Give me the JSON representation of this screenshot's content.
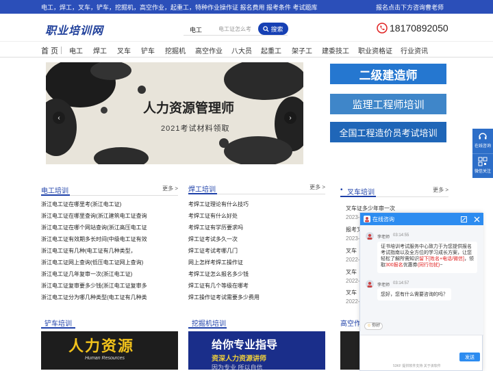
{
  "topbar": {
    "links": "电工，焊工，叉车，铲车，挖掘机，高空作业，起重工，特种作业操作证 报名费用 报考条件 考试题库",
    "right": "报名点击下方咨询曹老师"
  },
  "header": {
    "logo": "职业培训网",
    "search_keyword": "电工",
    "search_placeholder": "电工证怎么考",
    "search_button": "搜索",
    "phone": "18170892050"
  },
  "nav": [
    "首 页",
    "电工",
    "焊工",
    "叉车",
    "铲车",
    "挖掘机",
    "高空作业",
    "八大员",
    "起重工",
    "架子工",
    "建委技工",
    "职业资格证",
    "行业资讯"
  ],
  "banner": {
    "title": "人力资源管理师",
    "subtitle": "2021考试材料领取",
    "prev": "‹",
    "next": "›"
  },
  "promos": [
    "二级建造师",
    "监理工程师培训",
    "全国工程造价员考试培训"
  ],
  "sections": {
    "electric": {
      "title": "电工培训",
      "more": "更多 >",
      "items": [
        "浙江电工证在哪里考(浙江电工证)",
        "浙江电工证在哪里查询(浙江建筑电工证查询",
        "浙江电工证在哪个网站查询(浙江高压电工证",
        "浙江电工证有效期多长时间(中级电工证有效",
        "浙江电工证有几种(电工证有几种类型，",
        "浙江电工证网上查询(低压电工证网上查询)",
        "浙江电工证几年复审一次(浙江电工证)",
        "浙江电工证复审要多少钱(浙江电工证复审多",
        "浙江电工证分为哪几种类型(电工证有几种类"
      ]
    },
    "welder": {
      "title": "焊工培训",
      "more": "更多 >",
      "items": [
        "考焊工证理论有什么技巧",
        "考焊工证有什么好处",
        "考焊工证有学历要求吗",
        "焊工证考试多久一次",
        "焊工证考试考哪几门",
        "网上怎样考焊工操作证",
        "考焊工证怎么报名多少钱",
        "焊工证有几个等级在哪考",
        "焊工操作证考试需要多少费用"
      ]
    },
    "forklift": {
      "bullet": "•",
      "title": "叉车培训",
      "more": "更多 >",
      "items": [
        "叉车证多少年审一次",
        "报考叉",
        "叉车",
        "叉车",
        "叉车"
      ],
      "dates": [
        "2023-",
        "2023-",
        "2022-",
        "2022-",
        "2022-"
      ]
    },
    "loader": {
      "title": "铲车培训"
    },
    "excavator": {
      "title": "挖掘机培训"
    },
    "aerial": {
      "title": "高空作业"
    }
  },
  "images": {
    "loader": {
      "big": "人力资源",
      "sub": "Human Resources"
    },
    "excavator": {
      "big": "给你专业指导",
      "sub": "资深人力资源讲师",
      "sub2": "因为专业 所以自信"
    }
  },
  "chat": {
    "title": "在线咨询",
    "agent": "李老师",
    "time1": "03:14:55",
    "msg_a": "证书培训考试服务中心致力于为您提供报名考试指南以及全方位的学习成长方案，让您轻松了解所需知识",
    "msg_red1": "留下[姓名+电话/微信]",
    "msg_b": "，领取",
    "msg_red2": "300报名",
    "msg_c": "优惠券",
    "msg_red3": "(同行勿扰)",
    "msg_d": "~",
    "time2": "03:14:57",
    "msg2": "您好，您有什么需要咨询的吗？",
    "emoji": "你好",
    "send": "发送",
    "footer": "53KF 提供软件支持  关于该软件"
  },
  "side": {
    "online": "在线咨询",
    "wechat": "微信关注"
  },
  "colors": {
    "brand": "#2b4fb9",
    "nav_accent": "#1c3fa8",
    "chat": "#2d8cf0",
    "red": "#e02020"
  }
}
